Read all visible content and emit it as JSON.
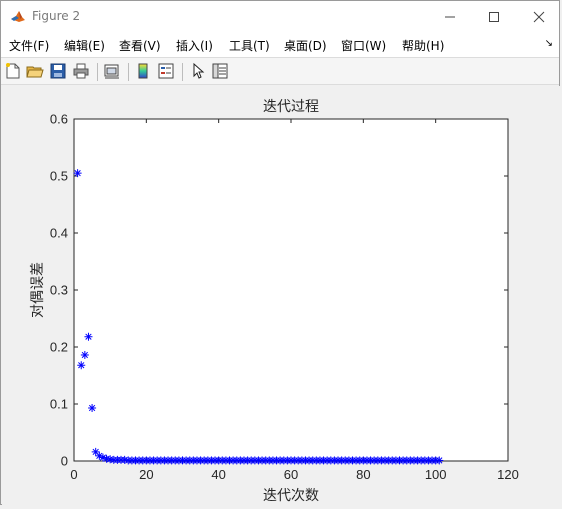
{
  "window": {
    "title": "Figure 2"
  },
  "menu": [
    "文件(F)",
    "编辑(E)",
    "查看(V)",
    "插入(I)",
    "工具(T)",
    "桌面(D)",
    "窗口(W)",
    "帮助(H)"
  ],
  "menu_arrow": "↘",
  "toolbar_icons": [
    "new-figure-icon",
    "open-file-icon",
    "save-icon",
    "print-icon",
    "link-figure-icon",
    "insert-colorbar-icon",
    "insert-legend-icon",
    "edit-plot-icon",
    "property-inspector-icon"
  ],
  "chart_data": {
    "type": "scatter",
    "title": "迭代过程",
    "xlabel": "迭代次数",
    "ylabel": "对偶误差",
    "xlim": [
      0,
      120
    ],
    "ylim": [
      0,
      0.6
    ],
    "xticks": [
      0,
      20,
      40,
      60,
      80,
      100,
      120
    ],
    "yticks": [
      0,
      0.1,
      0.2,
      0.3,
      0.4,
      0.5,
      0.6
    ],
    "grid": false,
    "marker": "*",
    "color": "#0000ff",
    "x": [
      1,
      2,
      3,
      4,
      5,
      6,
      7,
      8,
      9,
      10,
      11,
      12,
      13,
      14,
      15,
      16,
      17,
      18,
      19,
      20,
      21,
      22,
      23,
      24,
      25,
      26,
      27,
      28,
      29,
      30,
      31,
      32,
      33,
      34,
      35,
      36,
      37,
      38,
      39,
      40,
      41,
      42,
      43,
      44,
      45,
      46,
      47,
      48,
      49,
      50,
      51,
      52,
      53,
      54,
      55,
      56,
      57,
      58,
      59,
      60,
      61,
      62,
      63,
      64,
      65,
      66,
      67,
      68,
      69,
      70,
      71,
      72,
      73,
      74,
      75,
      76,
      77,
      78,
      79,
      80,
      81,
      82,
      83,
      84,
      85,
      86,
      87,
      88,
      89,
      90,
      91,
      92,
      93,
      94,
      95,
      96,
      97,
      98,
      99,
      100,
      101
    ],
    "y": [
      0.505,
      0.168,
      0.186,
      0.218,
      0.093,
      0.016,
      0.009,
      0.006,
      0.004,
      0.003,
      0.002,
      0.002,
      0.002,
      0.002,
      0.001,
      0.001,
      0.001,
      0.001,
      0.001,
      0.001,
      0.001,
      0.001,
      0.001,
      0.001,
      0.001,
      0.001,
      0.001,
      0.001,
      0.001,
      0.001,
      0.001,
      0.001,
      0.001,
      0.001,
      0.001,
      0.001,
      0.001,
      0.001,
      0.001,
      0.001,
      0.001,
      0.001,
      0.001,
      0.001,
      0.001,
      0.001,
      0.001,
      0.001,
      0.001,
      0.001,
      0.001,
      0.001,
      0.001,
      0.001,
      0.001,
      0.001,
      0.001,
      0.001,
      0.001,
      0.001,
      0.001,
      0.001,
      0.001,
      0.001,
      0.001,
      0.001,
      0.001,
      0.001,
      0.001,
      0.001,
      0.001,
      0.001,
      0.001,
      0.001,
      0.001,
      0.001,
      0.001,
      0.001,
      0.001,
      0.001,
      0.001,
      0.001,
      0.001,
      0.001,
      0.001,
      0.001,
      0.001,
      0.001,
      0.001,
      0.001,
      0.001,
      0.001,
      0.001,
      0.001,
      0.001,
      0.001,
      0.001,
      0.001,
      0.001,
      0.001,
      0.001
    ]
  }
}
